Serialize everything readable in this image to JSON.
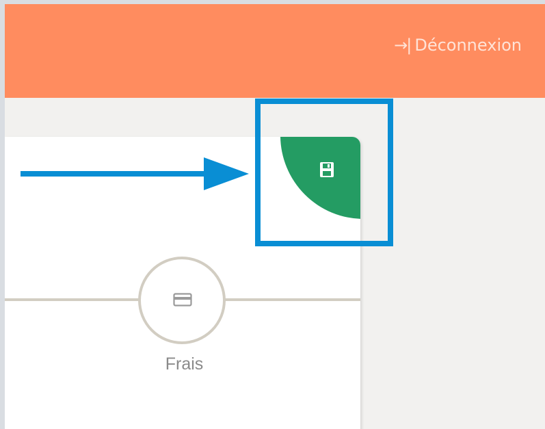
{
  "header": {
    "logout_label": "Déconnexion",
    "logout_icon": "→|",
    "background_color": "#ff8c5f"
  },
  "toolbar": {
    "save_icon": "save-icon",
    "save_color": "#249c63"
  },
  "steps": [
    {
      "label": "Frais",
      "icon": "credit-card-icon"
    }
  ],
  "annotations": {
    "highlight_color": "#098ed4",
    "arrow_color": "#098ed4"
  }
}
